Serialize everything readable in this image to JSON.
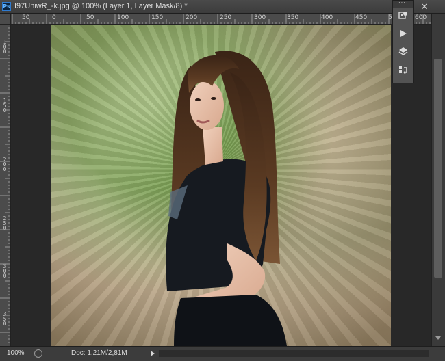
{
  "window": {
    "app_icon": "Ps",
    "title": "I97UniwR_-k.jpg @ 100% (Layer 1, Layer Mask/8) *",
    "min_glyph": "▸▸",
    "close_glyph": "✕"
  },
  "ruler": {
    "top_labels": [
      "50",
      "0",
      "50",
      "100",
      "150",
      "200",
      "250",
      "300",
      "350",
      "400",
      "450",
      "500",
      "55",
      "600"
    ],
    "left_labels": [
      "1",
      "0",
      "0",
      "1",
      "5",
      "0",
      "2",
      "0",
      "0",
      "2",
      "5",
      "0",
      "3",
      "0",
      "0",
      "3",
      "5",
      "0",
      "4",
      "0",
      "0"
    ]
  },
  "panel_dock": {
    "items": [
      {
        "name": "history-brush-panel",
        "icon": "history-icon"
      },
      {
        "name": "actions-panel",
        "icon": "play-icon"
      },
      {
        "name": "layers-panel",
        "icon": "layers-icon"
      },
      {
        "name": "history-panel",
        "icon": "history-states-icon"
      }
    ]
  },
  "status": {
    "zoom": "100%",
    "doc_info": "Doc: 1,21M/2,81M"
  },
  "colors": {
    "chrome": "#3a3a3a",
    "canvas_bg": "#282828",
    "ps_blue": "#2e7bd1"
  }
}
